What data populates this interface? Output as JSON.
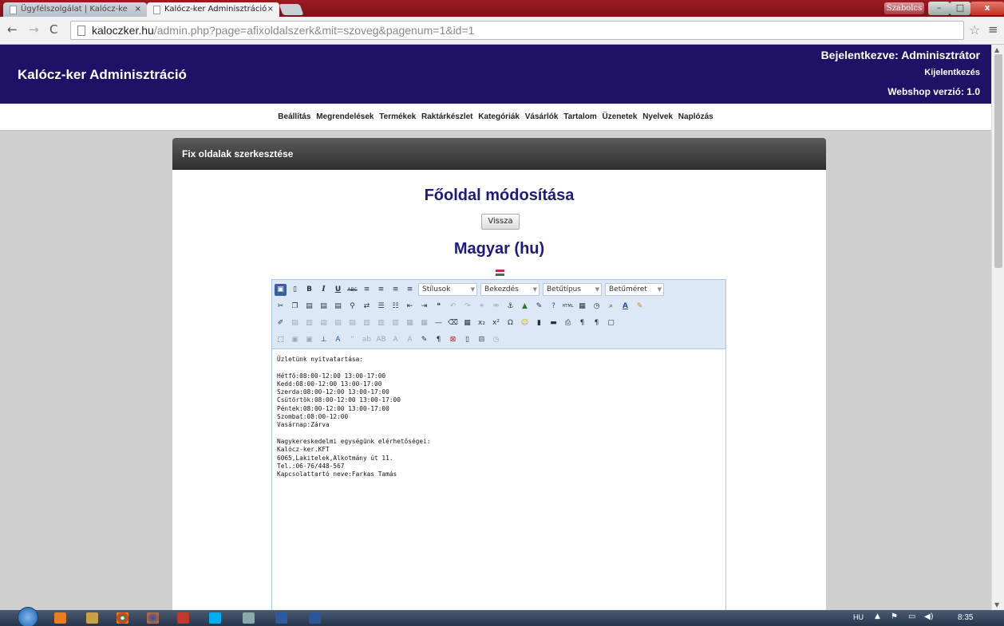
{
  "browser": {
    "tabs": [
      {
        "label": "Ügyfélszolgálat | Kalócz-ke",
        "active": false
      },
      {
        "label": "Kalócz-ker Adminisztráció",
        "active": true
      }
    ],
    "tab_close": "×",
    "user_button": "Szabolcs",
    "url_host": "kaloczker.hu",
    "url_path": "/admin.php?page=afixoldalszerk&mit=szoveg&pagenum=1&id=1"
  },
  "header": {
    "title": "Kalócz-ker Adminisztráció",
    "login": "Bejelentkezve: Adminisztrátor",
    "logout": "Kijelentkezés",
    "version": "Webshop verzió: 1.0",
    "background": "#1e1166"
  },
  "menu": [
    "Beállítás",
    "Megrendelések",
    "Termékek",
    "Raktárkészlet",
    "Kategóriák",
    "Vásárlók",
    "Tartalom",
    "Üzenetek",
    "Nyelvek",
    "Naplózás"
  ],
  "panel": {
    "title": "Fix oldalak szerkesztése",
    "heading": "Főoldal módosítása",
    "back_button": "Vissza",
    "language_heading": "Magyar (hu)",
    "flag_colors": [
      "#cd2a3e",
      "#ffffff",
      "#436f4d"
    ]
  },
  "editor": {
    "selects": [
      "Stílusok",
      "Bekezdés",
      "Betűtípus",
      "Betűméret"
    ],
    "content_lines": [
      "Üzletünk nyitvatartása:",
      "",
      "Hétfő:08:00-12:00 13:00-17:00",
      "Kedd:08:00-12:00 13:00-17:00",
      "Szerda:08:00-12:00 13:00-17:00",
      "Csütörtök:08:00-12:00 13:00-17:00",
      "Péntek:08:00-12:00 13:00-17:00",
      "Szombat:08:00-12:00",
      "Vasárnap:Zárva",
      "",
      "Nagykereskedelmi egységünk elérhetőségei:",
      "Kalócz-ker.KFT",
      "6065,Lakitelek,Alkotmány út 11.",
      "Tel.:06-76/448-567",
      "Kapcsolattartó neve:Farkas Tamás"
    ]
  },
  "taskbar": {
    "language": "HU",
    "clock": "8:35"
  }
}
